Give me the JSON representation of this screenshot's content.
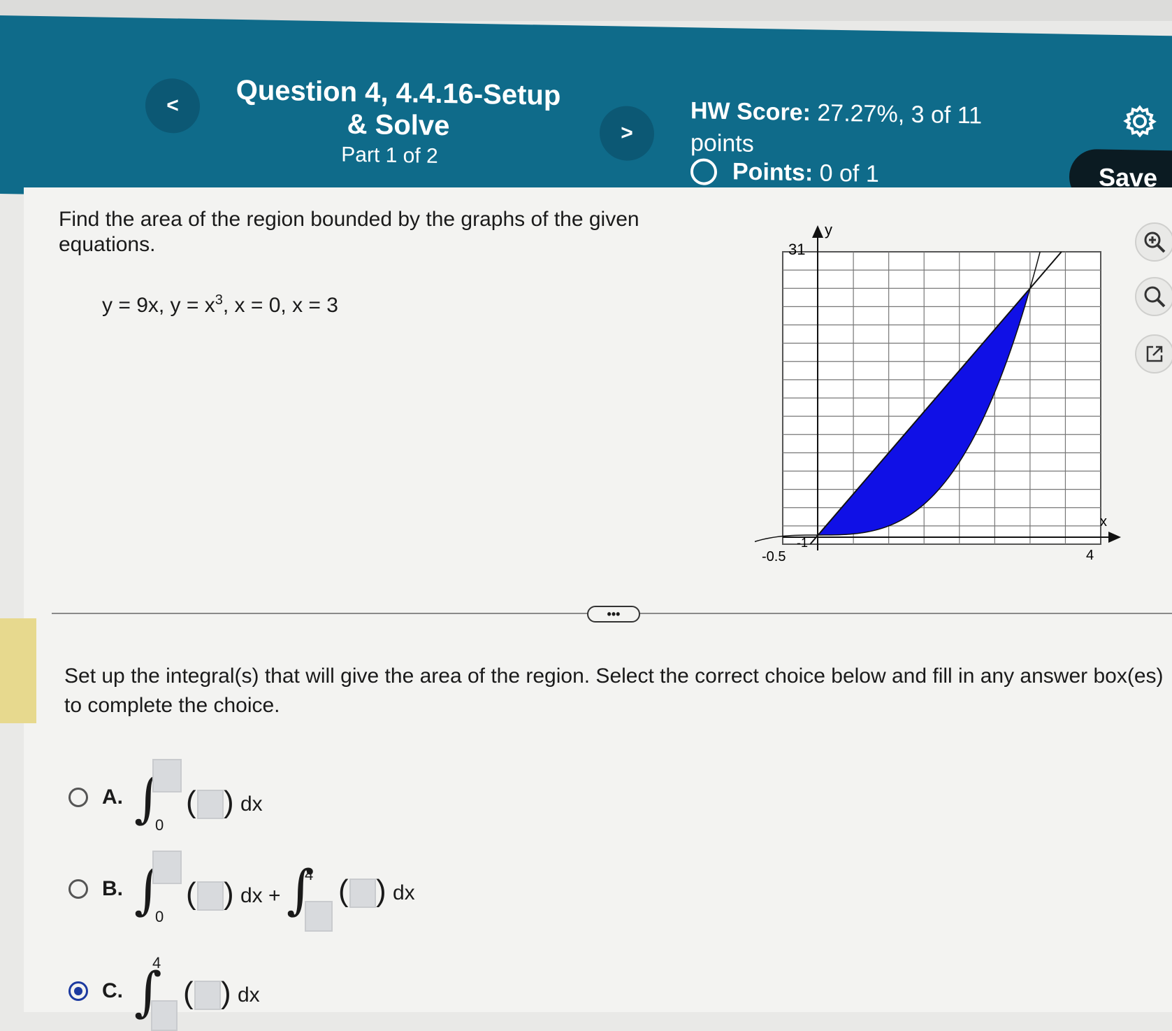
{
  "header": {
    "prev_label": "<",
    "next_label": ">",
    "question_title": "Question 4, 4.4.16-Setup & Solve",
    "part": "Part 1 of 2",
    "hw_score_label": "HW Score:",
    "hw_score_value": "27.27%, 3 of 11 points",
    "points_label": "Points:",
    "points_value": "0 of 1",
    "save_label": "Save",
    "settings_icon": "gear-icon"
  },
  "problem": {
    "text": "Find the area of the region bounded by the graphs of the given equations.",
    "eq_part1": "y = 9x, y = x",
    "eq_exp": "3",
    "eq_part2": ", x = 0, x = 3"
  },
  "graph": {
    "y_label": "y",
    "x_label": "x",
    "y_max_label": "31",
    "x_min_label": "-0.5",
    "y_min_label": "-1",
    "x_max_label": "4",
    "fill_color": "#1010e6"
  },
  "tools": {
    "zoom_in_icon": "zoom-in-icon",
    "zoom_out_icon": "zoom-out-icon",
    "popout_icon": "popout-icon"
  },
  "more_label": "•••",
  "instruction": "Set up the integral(s) that will give the area of the region. Select the correct choice below and fill in any answer box(es) to complete the choice.",
  "choices": [
    {
      "label": "A.",
      "lower": "0",
      "dx": "dx",
      "selected": false
    },
    {
      "label": "B.",
      "lower": "0",
      "upper2": "4",
      "dx": "dx +",
      "dx2": "dx",
      "selected": false
    },
    {
      "label": "C.",
      "upper": "4",
      "dx": "dx",
      "selected": true
    }
  ]
}
